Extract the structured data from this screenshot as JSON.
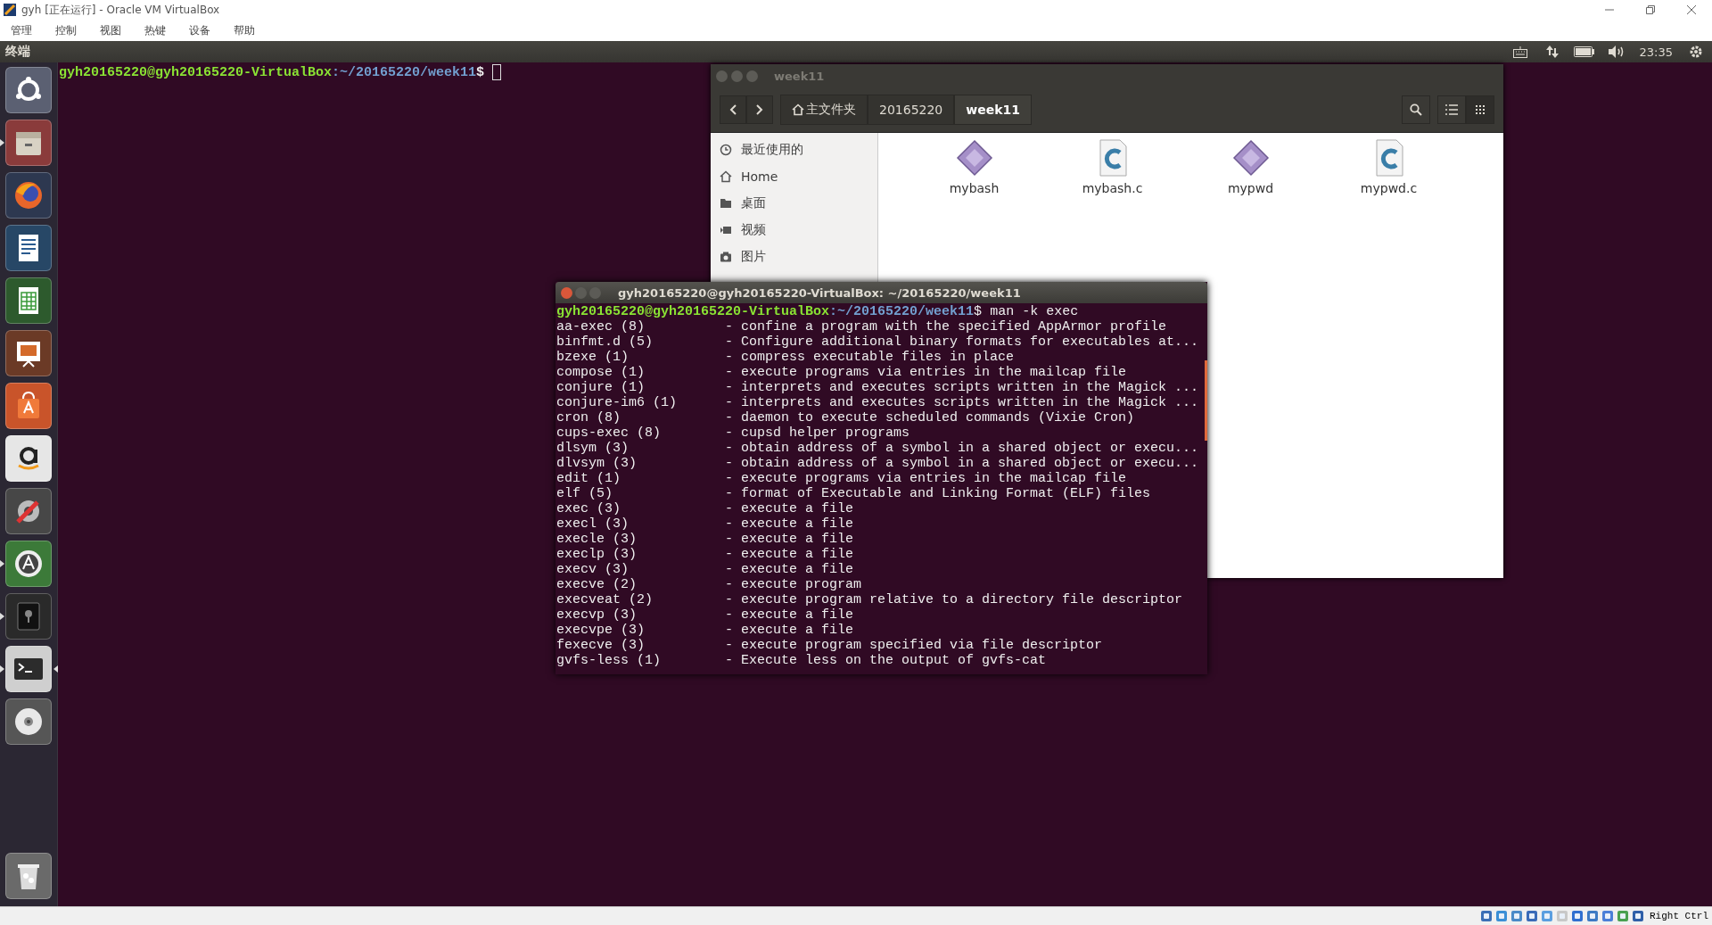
{
  "vbox": {
    "title": "gyh [正在运行] - Oracle VM VirtualBox",
    "menu": [
      "管理",
      "控制",
      "视图",
      "热键",
      "设备",
      "帮助"
    ],
    "host_key": "Right Ctrl"
  },
  "panel": {
    "app_name": "终端",
    "clock": "23:35"
  },
  "launcher": [
    {
      "kind": "dash",
      "running": false,
      "focused": false
    },
    {
      "kind": "files",
      "running": true,
      "focused": false
    },
    {
      "kind": "browser",
      "running": false,
      "focused": false
    },
    {
      "kind": "writer",
      "running": false,
      "focused": false
    },
    {
      "kind": "calc",
      "running": false,
      "focused": false
    },
    {
      "kind": "impress",
      "running": false,
      "focused": false
    },
    {
      "kind": "software",
      "running": false,
      "focused": false
    },
    {
      "kind": "shop",
      "running": false,
      "focused": false
    },
    {
      "kind": "settings",
      "running": false,
      "focused": false
    },
    {
      "kind": "updater",
      "running": true,
      "focused": false
    },
    {
      "kind": "safe",
      "running": true,
      "focused": false
    },
    {
      "kind": "terminal",
      "running": true,
      "focused": true
    },
    {
      "kind": "disc",
      "running": false,
      "focused": false
    },
    {
      "kind": "trash",
      "running": false,
      "focused": false
    }
  ],
  "background_terminal": {
    "user_host": "gyh20165220@gyh20165220-VirtualBox",
    "path": ":~/20165220/week11",
    "symbol": "$"
  },
  "file_manager": {
    "title": "week11",
    "path": [
      {
        "label": "主文件夹",
        "kind": "home",
        "selected": false
      },
      {
        "label": "20165220",
        "kind": "folder",
        "selected": false
      },
      {
        "label": "week11",
        "kind": "folder",
        "selected": true
      }
    ],
    "view_modes": [
      {
        "kind": "list",
        "selected": false
      },
      {
        "kind": "grid",
        "selected": true
      }
    ],
    "sidebar": [
      {
        "label": "最近使用的",
        "kind": "recent"
      },
      {
        "label": "Home",
        "kind": "home"
      },
      {
        "label": "桌面",
        "kind": "folder"
      },
      {
        "label": "视频",
        "kind": "video"
      },
      {
        "label": "图片",
        "kind": "camera"
      }
    ],
    "files": [
      {
        "name": "mybash",
        "kind": "executable"
      },
      {
        "name": "mybash.c",
        "kind": "c-source"
      },
      {
        "name": "mypwd",
        "kind": "executable"
      },
      {
        "name": "mypwd.c",
        "kind": "c-source"
      }
    ]
  },
  "terminal": {
    "title": "gyh20165220@gyh20165220-VirtualBox: ~/20165220/week11",
    "user_host": "gyh20165220@gyh20165220-VirtualBox",
    "path": ":~/20165220/week11",
    "symbol": "$",
    "command": "man -k exec",
    "lines": [
      {
        "name": "aa-exec (8)",
        "description": "- confine a program with the specified AppArmor profile"
      },
      {
        "name": "binfmt.d (5)",
        "description": "- Configure additional binary formats for executables at..."
      },
      {
        "name": "bzexe (1)",
        "description": "- compress executable files in place"
      },
      {
        "name": "compose (1)",
        "description": "- execute programs via entries in the mailcap file"
      },
      {
        "name": "conjure (1)",
        "description": "- interprets and executes scripts written in the Magick ..."
      },
      {
        "name": "conjure-im6 (1)",
        "description": "- interprets and executes scripts written in the Magick ..."
      },
      {
        "name": "cron (8)",
        "description": "- daemon to execute scheduled commands (Vixie Cron)"
      },
      {
        "name": "cups-exec (8)",
        "description": "- cupsd helper programs"
      },
      {
        "name": "dlsym (3)",
        "description": "- obtain address of a symbol in a shared object or execu..."
      },
      {
        "name": "dlvsym (3)",
        "description": "- obtain address of a symbol in a shared object or execu..."
      },
      {
        "name": "edit (1)",
        "description": "- execute programs via entries in the mailcap file"
      },
      {
        "name": "elf (5)",
        "description": "- format of Executable and Linking Format (ELF) files"
      },
      {
        "name": "exec (3)",
        "description": "- execute a file"
      },
      {
        "name": "execl (3)",
        "description": "- execute a file"
      },
      {
        "name": "execle (3)",
        "description": "- execute a file"
      },
      {
        "name": "execlp (3)",
        "description": "- execute a file"
      },
      {
        "name": "execv (3)",
        "description": "- execute a file"
      },
      {
        "name": "execve (2)",
        "description": "- execute program"
      },
      {
        "name": "execveat (2)",
        "description": "- execute program relative to a directory file descriptor"
      },
      {
        "name": "execvp (3)",
        "description": "- execute a file"
      },
      {
        "name": "execvpe (3)",
        "description": "- execute a file"
      },
      {
        "name": "fexecve (3)",
        "description": "- execute program specified via file descriptor"
      },
      {
        "name": "gvfs-less (1)",
        "description": "- Execute less on the output of gvfs-cat"
      }
    ]
  }
}
